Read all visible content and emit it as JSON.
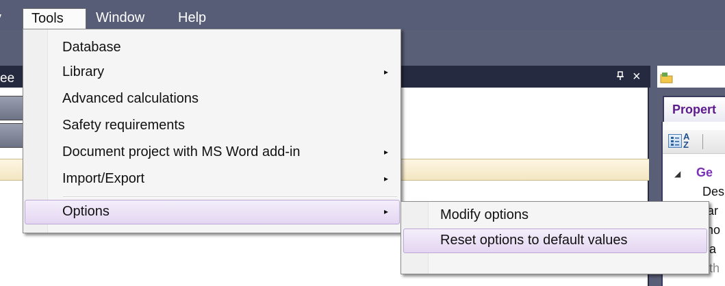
{
  "menubar": {
    "partial_left": "y",
    "items": [
      {
        "label": "Tools"
      },
      {
        "label": "Window"
      },
      {
        "label": "Help"
      }
    ]
  },
  "background_panel": {
    "title_partial": "ee",
    "pin_glyph": "q",
    "close_glyph": "×"
  },
  "tools_menu": {
    "items": [
      {
        "label": "Database",
        "has_submenu": false
      },
      {
        "label": "Library",
        "has_submenu": true
      },
      {
        "label": "Advanced calculations",
        "has_submenu": false
      },
      {
        "label": "Safety requirements",
        "has_submenu": false
      },
      {
        "label": "Document project with MS Word add-in",
        "has_submenu": true
      },
      {
        "label": "Import/Export",
        "has_submenu": true
      },
      {
        "label": "Options",
        "has_submenu": true,
        "highlighted": true
      }
    ],
    "arrow_glyph": "▸"
  },
  "options_submenu": {
    "items": [
      {
        "label": "Modify options"
      },
      {
        "label": "Reset options to default values",
        "highlighted": true
      }
    ]
  },
  "properties_panel": {
    "tab_label": "Propert",
    "sort_icon_top": "A",
    "sort_icon_bottom": "Z",
    "group_label": "Ge",
    "rows": [
      "Des",
      "Nar",
      "Sho",
      "Atta",
      "Path"
    ],
    "expand_glyph": "◢"
  },
  "colors": {
    "menubar_bg": "#575c77",
    "highlight_border": "#bba6d6",
    "group_text": "#7a2fb8"
  }
}
